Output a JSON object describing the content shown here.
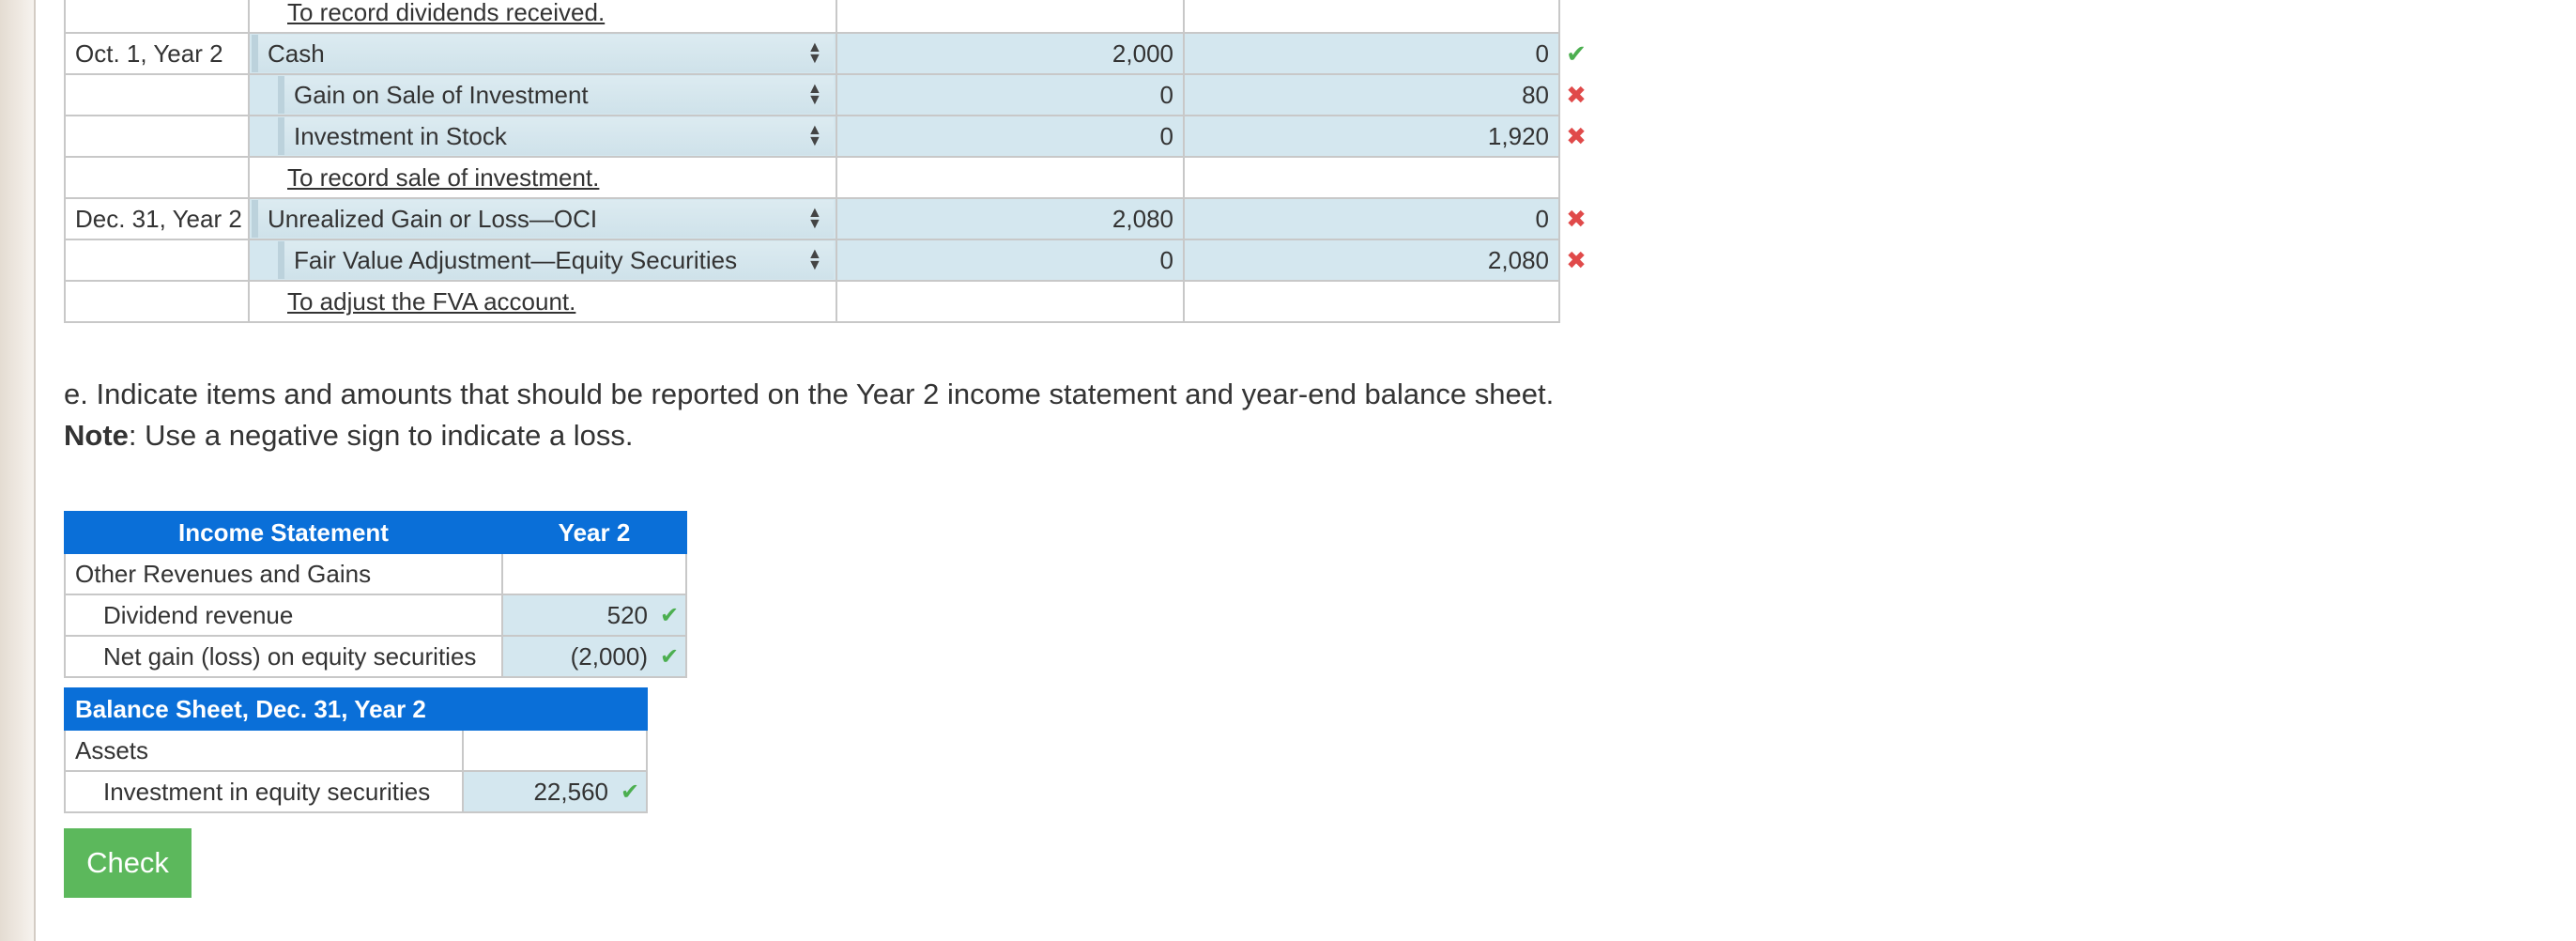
{
  "journal": {
    "rows": [
      {
        "date": "",
        "type": "memo",
        "memo": "To record dividends received."
      },
      {
        "date": "Oct. 1, Year 2",
        "type": "entry",
        "account": "Cash",
        "indent": false,
        "debit": "2,000",
        "credit": "0",
        "mark": "check"
      },
      {
        "date": "",
        "type": "entry",
        "account": "Gain on Sale of Investment",
        "indent": true,
        "debit": "0",
        "credit": "80",
        "mark": "cross"
      },
      {
        "date": "",
        "type": "entry",
        "account": "Investment in Stock",
        "indent": true,
        "debit": "0",
        "credit": "1,920",
        "mark": "cross"
      },
      {
        "date": "",
        "type": "memo",
        "memo": "To record sale of investment."
      },
      {
        "date": "Dec. 31, Year 2",
        "type": "entry",
        "account": "Unrealized Gain or Loss—OCI",
        "indent": false,
        "debit": "2,080",
        "credit": "0",
        "mark": "cross"
      },
      {
        "date": "",
        "type": "entry",
        "account": "Fair Value Adjustment—Equity Securities",
        "indent": true,
        "debit": "0",
        "credit": "2,080",
        "mark": "cross"
      },
      {
        "date": "",
        "type": "memo",
        "memo": "To adjust the FVA account."
      }
    ]
  },
  "instructions": {
    "line1": "e. Indicate items and amounts that should be reported on the Year 2 income statement and year-end balance sheet.",
    "note_label": "Note",
    "note_text": ": Use a negative sign to indicate a loss."
  },
  "income_statement": {
    "header": "Income Statement",
    "year_header": "Year 2",
    "section": "Other Revenues and Gains",
    "rows": [
      {
        "label": "Dividend revenue",
        "value": "520",
        "mark": "check"
      },
      {
        "label": "Net gain (loss) on equity securities",
        "value": "(2,000)",
        "mark": "check"
      }
    ]
  },
  "balance_sheet": {
    "header": "Balance Sheet, Dec. 31, Year 2",
    "section": "Assets",
    "rows": [
      {
        "label": "Investment in equity securities",
        "value": "22,560",
        "mark": "check"
      }
    ]
  },
  "check_button": {
    "label": "Check"
  },
  "icons": {
    "check": "checkmark-icon",
    "cross": "cross-icon",
    "stepper": "up-down-arrows-icon"
  },
  "colors": {
    "header_blue": "#0a6fd8",
    "input_shade": "#d4e7ef",
    "check_green": "#4caf50",
    "cross_red": "#e04a4a",
    "button_green": "#5cb85c"
  }
}
